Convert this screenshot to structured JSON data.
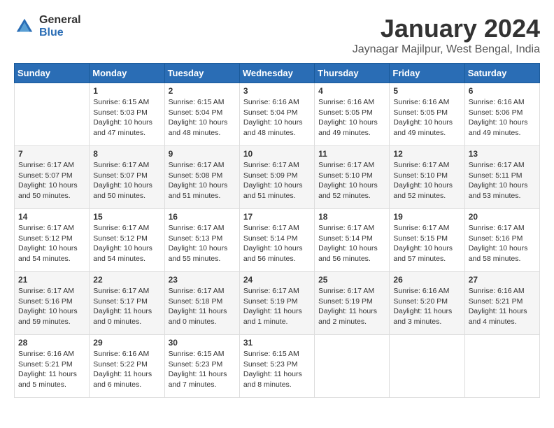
{
  "logo": {
    "general": "General",
    "blue": "Blue"
  },
  "title": "January 2024",
  "location": "Jaynagar Majilpur, West Bengal, India",
  "headers": [
    "Sunday",
    "Monday",
    "Tuesday",
    "Wednesday",
    "Thursday",
    "Friday",
    "Saturday"
  ],
  "weeks": [
    [
      {
        "day": "",
        "sunrise": "",
        "sunset": "",
        "daylight": ""
      },
      {
        "day": "1",
        "sunrise": "Sunrise: 6:15 AM",
        "sunset": "Sunset: 5:03 PM",
        "daylight": "Daylight: 10 hours and 47 minutes."
      },
      {
        "day": "2",
        "sunrise": "Sunrise: 6:15 AM",
        "sunset": "Sunset: 5:04 PM",
        "daylight": "Daylight: 10 hours and 48 minutes."
      },
      {
        "day": "3",
        "sunrise": "Sunrise: 6:16 AM",
        "sunset": "Sunset: 5:04 PM",
        "daylight": "Daylight: 10 hours and 48 minutes."
      },
      {
        "day": "4",
        "sunrise": "Sunrise: 6:16 AM",
        "sunset": "Sunset: 5:05 PM",
        "daylight": "Daylight: 10 hours and 49 minutes."
      },
      {
        "day": "5",
        "sunrise": "Sunrise: 6:16 AM",
        "sunset": "Sunset: 5:05 PM",
        "daylight": "Daylight: 10 hours and 49 minutes."
      },
      {
        "day": "6",
        "sunrise": "Sunrise: 6:16 AM",
        "sunset": "Sunset: 5:06 PM",
        "daylight": "Daylight: 10 hours and 49 minutes."
      }
    ],
    [
      {
        "day": "7",
        "sunrise": "Sunrise: 6:17 AM",
        "sunset": "Sunset: 5:07 PM",
        "daylight": "Daylight: 10 hours and 50 minutes."
      },
      {
        "day": "8",
        "sunrise": "Sunrise: 6:17 AM",
        "sunset": "Sunset: 5:07 PM",
        "daylight": "Daylight: 10 hours and 50 minutes."
      },
      {
        "day": "9",
        "sunrise": "Sunrise: 6:17 AM",
        "sunset": "Sunset: 5:08 PM",
        "daylight": "Daylight: 10 hours and 51 minutes."
      },
      {
        "day": "10",
        "sunrise": "Sunrise: 6:17 AM",
        "sunset": "Sunset: 5:09 PM",
        "daylight": "Daylight: 10 hours and 51 minutes."
      },
      {
        "day": "11",
        "sunrise": "Sunrise: 6:17 AM",
        "sunset": "Sunset: 5:10 PM",
        "daylight": "Daylight: 10 hours and 52 minutes."
      },
      {
        "day": "12",
        "sunrise": "Sunrise: 6:17 AM",
        "sunset": "Sunset: 5:10 PM",
        "daylight": "Daylight: 10 hours and 52 minutes."
      },
      {
        "day": "13",
        "sunrise": "Sunrise: 6:17 AM",
        "sunset": "Sunset: 5:11 PM",
        "daylight": "Daylight: 10 hours and 53 minutes."
      }
    ],
    [
      {
        "day": "14",
        "sunrise": "Sunrise: 6:17 AM",
        "sunset": "Sunset: 5:12 PM",
        "daylight": "Daylight: 10 hours and 54 minutes."
      },
      {
        "day": "15",
        "sunrise": "Sunrise: 6:17 AM",
        "sunset": "Sunset: 5:12 PM",
        "daylight": "Daylight: 10 hours and 54 minutes."
      },
      {
        "day": "16",
        "sunrise": "Sunrise: 6:17 AM",
        "sunset": "Sunset: 5:13 PM",
        "daylight": "Daylight: 10 hours and 55 minutes."
      },
      {
        "day": "17",
        "sunrise": "Sunrise: 6:17 AM",
        "sunset": "Sunset: 5:14 PM",
        "daylight": "Daylight: 10 hours and 56 minutes."
      },
      {
        "day": "18",
        "sunrise": "Sunrise: 6:17 AM",
        "sunset": "Sunset: 5:14 PM",
        "daylight": "Daylight: 10 hours and 56 minutes."
      },
      {
        "day": "19",
        "sunrise": "Sunrise: 6:17 AM",
        "sunset": "Sunset: 5:15 PM",
        "daylight": "Daylight: 10 hours and 57 minutes."
      },
      {
        "day": "20",
        "sunrise": "Sunrise: 6:17 AM",
        "sunset": "Sunset: 5:16 PM",
        "daylight": "Daylight: 10 hours and 58 minutes."
      }
    ],
    [
      {
        "day": "21",
        "sunrise": "Sunrise: 6:17 AM",
        "sunset": "Sunset: 5:16 PM",
        "daylight": "Daylight: 10 hours and 59 minutes."
      },
      {
        "day": "22",
        "sunrise": "Sunrise: 6:17 AM",
        "sunset": "Sunset: 5:17 PM",
        "daylight": "Daylight: 11 hours and 0 minutes."
      },
      {
        "day": "23",
        "sunrise": "Sunrise: 6:17 AM",
        "sunset": "Sunset: 5:18 PM",
        "daylight": "Daylight: 11 hours and 0 minutes."
      },
      {
        "day": "24",
        "sunrise": "Sunrise: 6:17 AM",
        "sunset": "Sunset: 5:19 PM",
        "daylight": "Daylight: 11 hours and 1 minute."
      },
      {
        "day": "25",
        "sunrise": "Sunrise: 6:17 AM",
        "sunset": "Sunset: 5:19 PM",
        "daylight": "Daylight: 11 hours and 2 minutes."
      },
      {
        "day": "26",
        "sunrise": "Sunrise: 6:16 AM",
        "sunset": "Sunset: 5:20 PM",
        "daylight": "Daylight: 11 hours and 3 minutes."
      },
      {
        "day": "27",
        "sunrise": "Sunrise: 6:16 AM",
        "sunset": "Sunset: 5:21 PM",
        "daylight": "Daylight: 11 hours and 4 minutes."
      }
    ],
    [
      {
        "day": "28",
        "sunrise": "Sunrise: 6:16 AM",
        "sunset": "Sunset: 5:21 PM",
        "daylight": "Daylight: 11 hours and 5 minutes."
      },
      {
        "day": "29",
        "sunrise": "Sunrise: 6:16 AM",
        "sunset": "Sunset: 5:22 PM",
        "daylight": "Daylight: 11 hours and 6 minutes."
      },
      {
        "day": "30",
        "sunrise": "Sunrise: 6:15 AM",
        "sunset": "Sunset: 5:23 PM",
        "daylight": "Daylight: 11 hours and 7 minutes."
      },
      {
        "day": "31",
        "sunrise": "Sunrise: 6:15 AM",
        "sunset": "Sunset: 5:23 PM",
        "daylight": "Daylight: 11 hours and 8 minutes."
      },
      {
        "day": "",
        "sunrise": "",
        "sunset": "",
        "daylight": ""
      },
      {
        "day": "",
        "sunrise": "",
        "sunset": "",
        "daylight": ""
      },
      {
        "day": "",
        "sunrise": "",
        "sunset": "",
        "daylight": ""
      }
    ]
  ]
}
